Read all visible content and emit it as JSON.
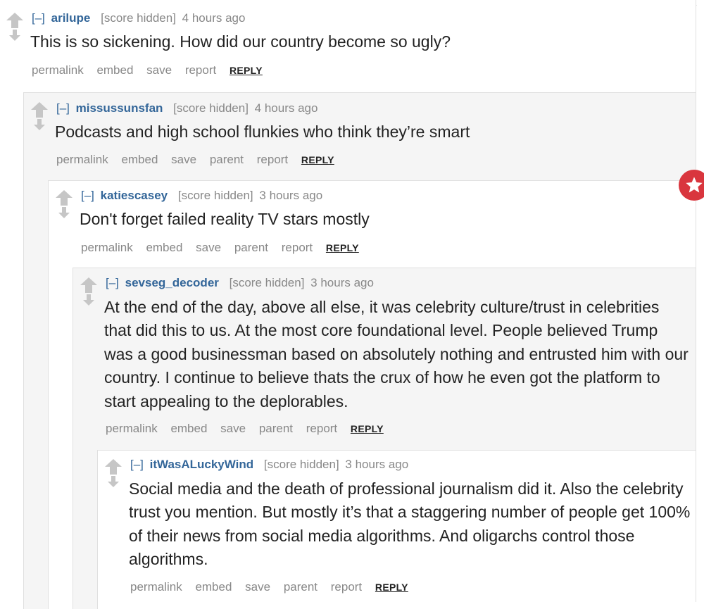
{
  "comments": [
    {
      "collapse": "[–]",
      "author": "arilupe",
      "score": "[score hidden]",
      "time": "4 hours ago",
      "body": "This is so sickening.  How did our country become so ugly?",
      "actions": [
        "permalink",
        "embed",
        "save",
        "report"
      ],
      "reply": "REPLY"
    },
    {
      "collapse": "[–]",
      "author": "missussunsfan",
      "score": "[score hidden]",
      "time": "4 hours ago",
      "body": "Podcasts and high school flunkies who think they’re smart",
      "actions": [
        "permalink",
        "embed",
        "save",
        "parent",
        "report"
      ],
      "reply": "REPLY"
    },
    {
      "collapse": "[–]",
      "author": "katiescasey",
      "score": "[score hidden]",
      "time": "3 hours ago",
      "body": "Don't forget failed reality TV stars mostly",
      "actions": [
        "permalink",
        "embed",
        "save",
        "parent",
        "report"
      ],
      "reply": "REPLY"
    },
    {
      "collapse": "[–]",
      "author": "sevseg_decoder",
      "score": "[score hidden]",
      "time": "3 hours ago",
      "body": "At the end of the day, above all else, it was celebrity culture/trust in celebrities that did this to us. At the most core foundational level. People believed Trump was a good businessman based on absolutely nothing and entrusted him with our country. I continue to believe thats the crux of how he even got the platform to start appealing to the deplorables.",
      "actions": [
        "permalink",
        "embed",
        "save",
        "parent",
        "report"
      ],
      "reply": "REPLY"
    },
    {
      "collapse": "[–]",
      "author": "itWasALuckyWind",
      "score": "[score hidden]",
      "time": "3 hours ago",
      "body": "Social media and the death of professional journalism did it. Also the celebrity trust you mention. But mostly it’s that a staggering number of people get 100% of their news from social media algorithms. And oligarchs control those algorithms.",
      "actions": [
        "permalink",
        "embed",
        "save",
        "parent",
        "report"
      ],
      "reply": "REPLY"
    }
  ],
  "icons": {
    "upvote": "upvote-arrow-icon",
    "downvote": "downvote-arrow-icon",
    "fab": "star-icon"
  },
  "colors": {
    "author": "#336699",
    "meta": "#888888",
    "body": "#222222",
    "nested_bg": "#f5f5f5",
    "fab": "#d9363e"
  }
}
